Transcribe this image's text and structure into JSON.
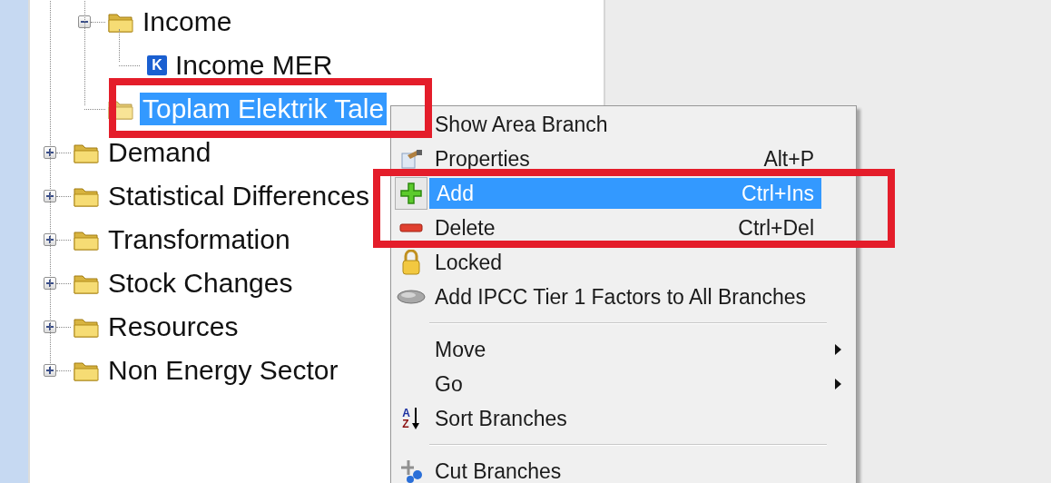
{
  "tree": {
    "items": [
      {
        "children": [
          {
            "kind": "folder",
            "label": "Income",
            "expanded": true,
            "selected": false,
            "children": [
              {
                "kind": "variable",
                "label": "Income MER",
                "badge": "K",
                "selected": false
              }
            ]
          },
          {
            "kind": "folder",
            "label": "Toplam Elektrik Tale",
            "selected": true
          }
        ]
      },
      {
        "kind": "folder",
        "label": "Demand",
        "expanded": false,
        "selected": false
      },
      {
        "kind": "folder",
        "label": "Statistical Differences",
        "expanded": false,
        "selected": false
      },
      {
        "kind": "folder",
        "label": "Transformation",
        "expanded": false,
        "selected": false
      },
      {
        "kind": "folder",
        "label": "Stock Changes",
        "expanded": false,
        "selected": false
      },
      {
        "kind": "folder",
        "label": "Resources",
        "expanded": false,
        "selected": false
      },
      {
        "kind": "folder",
        "label": "Non Energy Sector",
        "expanded": false,
        "selected": false
      }
    ]
  },
  "context_menu": {
    "items": [
      {
        "kind": "item",
        "label": "Show Area Branch",
        "selected": false
      },
      {
        "kind": "item",
        "label": "Properties",
        "shortcut": "Alt+P",
        "selected": false
      },
      {
        "kind": "item",
        "label": "Add",
        "shortcut": "Ctrl+Ins",
        "selected": true
      },
      {
        "kind": "item",
        "label": "Delete",
        "shortcut": "Ctrl+Del",
        "selected": false
      },
      {
        "kind": "item",
        "label": "Locked",
        "selected": false
      },
      {
        "kind": "item",
        "label": "Add IPCC Tier 1 Factors to All Branches",
        "selected": false
      },
      {
        "kind": "separator"
      },
      {
        "kind": "item",
        "label": "Move",
        "submenu": true,
        "selected": false
      },
      {
        "kind": "item",
        "label": "Go",
        "submenu": true,
        "selected": false
      },
      {
        "kind": "item",
        "label": "Sort Branches",
        "icon_text": [
          "A",
          "Z"
        ],
        "selected": false
      },
      {
        "kind": "separator"
      },
      {
        "kind": "item",
        "label": "Cut Branches",
        "selected": false
      }
    ]
  }
}
